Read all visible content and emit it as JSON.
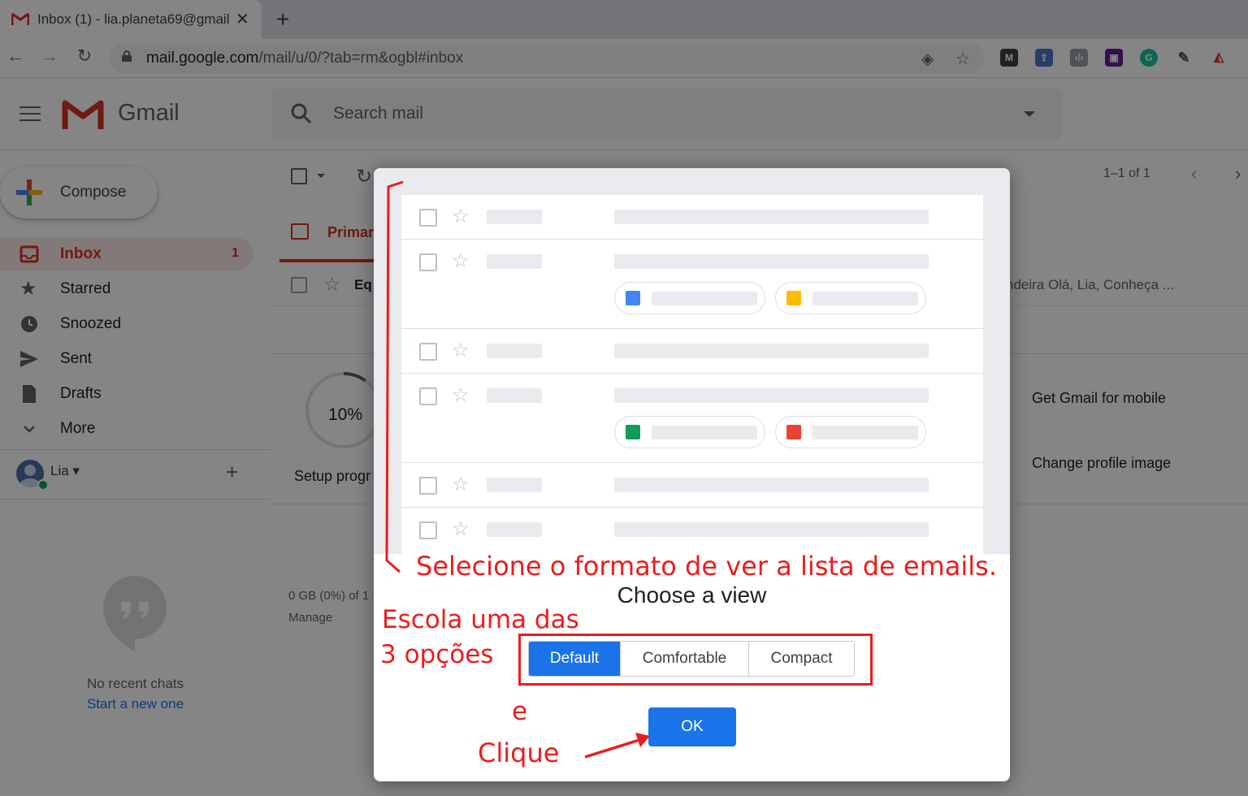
{
  "browser": {
    "tab_title": "Inbox (1) - lia.planeta69@gmail",
    "tab_close": "✕",
    "new_tab": "+",
    "url_host": "mail.google.com",
    "url_path": "/mail/u/0/?tab=rm&ogbl#inbox",
    "nav": {
      "back": "←",
      "forward": "→",
      "reload": "↻"
    }
  },
  "header": {
    "app_name": "Gmail",
    "search_placeholder": "Search mail"
  },
  "compose_label": "Compose",
  "sidebar": {
    "items": [
      {
        "label": "Inbox",
        "count": "1",
        "icon": "inbox-icon"
      },
      {
        "label": "Starred",
        "icon": "star-icon"
      },
      {
        "label": "Snoozed",
        "icon": "clock-icon"
      },
      {
        "label": "Sent",
        "icon": "send-icon"
      },
      {
        "label": "Drafts",
        "icon": "draft-icon"
      },
      {
        "label": "More",
        "icon": "chevron-down-icon"
      }
    ],
    "account_name": "Lia",
    "add_label": "+",
    "no_chats": "No recent chats",
    "start_new": "Start a new one"
  },
  "main": {
    "pager": "1–1 of 1",
    "tab_primary": "Primar",
    "email_sender": "Eq",
    "email_snippet": "ndeira Olá, Lia, Conheça ...",
    "setup_percent": "10%",
    "setup_label": "Setup progr",
    "setup_progress": 0.1,
    "tip_mobile": "Get Gmail for mobile",
    "tip_profile": "Change profile image",
    "storage": "0 GB (0%) of 1",
    "manage": "Manage"
  },
  "dialog": {
    "title": "Choose a view",
    "options": [
      "Default",
      "Comfortable",
      "Compact"
    ],
    "selected": "Default",
    "ok_label": "OK"
  },
  "annotations": {
    "top": "Selecione o formato de ver a lista de emails.",
    "left_line1": "Escola uma das",
    "left_line2": "3 opções",
    "e": "e",
    "clique": "Clique",
    "color": "#ec1c1c"
  },
  "colors": {
    "gmail_red": "#d93025",
    "accent_blue": "#1a73e8"
  }
}
